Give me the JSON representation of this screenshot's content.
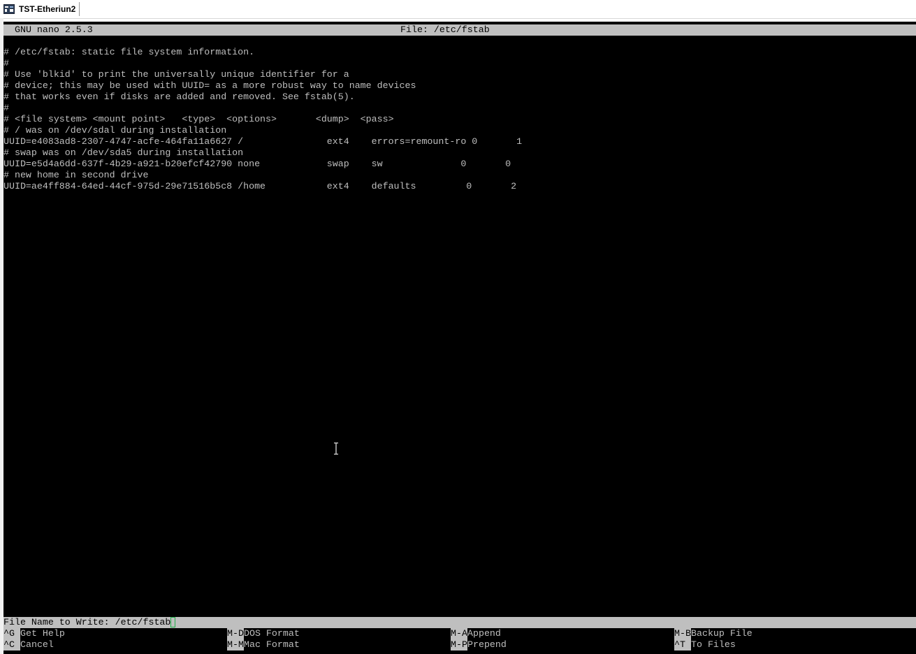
{
  "window": {
    "tab_title": "TST-Etheriun2",
    "tab_icon": "terminal-icon"
  },
  "nano": {
    "version": "GNU nano 2.5.3",
    "file_title": "File: /etc/fstab"
  },
  "lines": [
    "# /etc/fstab: static file system information.",
    "#",
    "# Use 'blkid' to print the universally unique identifier for a",
    "# device; this may be used with UUID= as a more robust way to name devices",
    "# that works even if disks are added and removed. See fstab(5).",
    "#",
    "# <file system> <mount point>   <type>  <options>       <dump>  <pass>",
    "# / was on /dev/sdal during installation",
    "UUID=e4083ad8-2307-4747-acfe-464fa11a6627 /               ext4    errors=remount-ro 0       1",
    "# swap was on /dev/sda5 during installation",
    "UUID=e5d4a6dd-637f-4b29-a921-b20efcf42790 none            swap    sw              0       0",
    "# new home in second drive",
    "UUID=ae4ff884-64ed-44cf-975d-29e71516b5c8 /home           ext4    defaults         0       2"
  ],
  "prompt": {
    "label": "File Name to Write: ",
    "value": "/etc/fstab"
  },
  "shortcuts": [
    {
      "key": "^G",
      "label": "Get Help"
    },
    {
      "key": "M-D",
      "label": "DOS Format"
    },
    {
      "key": "M-A",
      "label": "Append"
    },
    {
      "key": "M-B",
      "label": "Backup File"
    },
    {
      "key": "^C",
      "label": "Cancel"
    },
    {
      "key": "M-M",
      "label": "Mac Format"
    },
    {
      "key": "M-P",
      "label": "Prepend"
    },
    {
      "key": "^T",
      "label": "To Files"
    }
  ],
  "colors": {
    "background": "#000000",
    "foreground": "#bfbfbf",
    "bar": "#bfbfbf",
    "cursor": "#21b14b"
  }
}
